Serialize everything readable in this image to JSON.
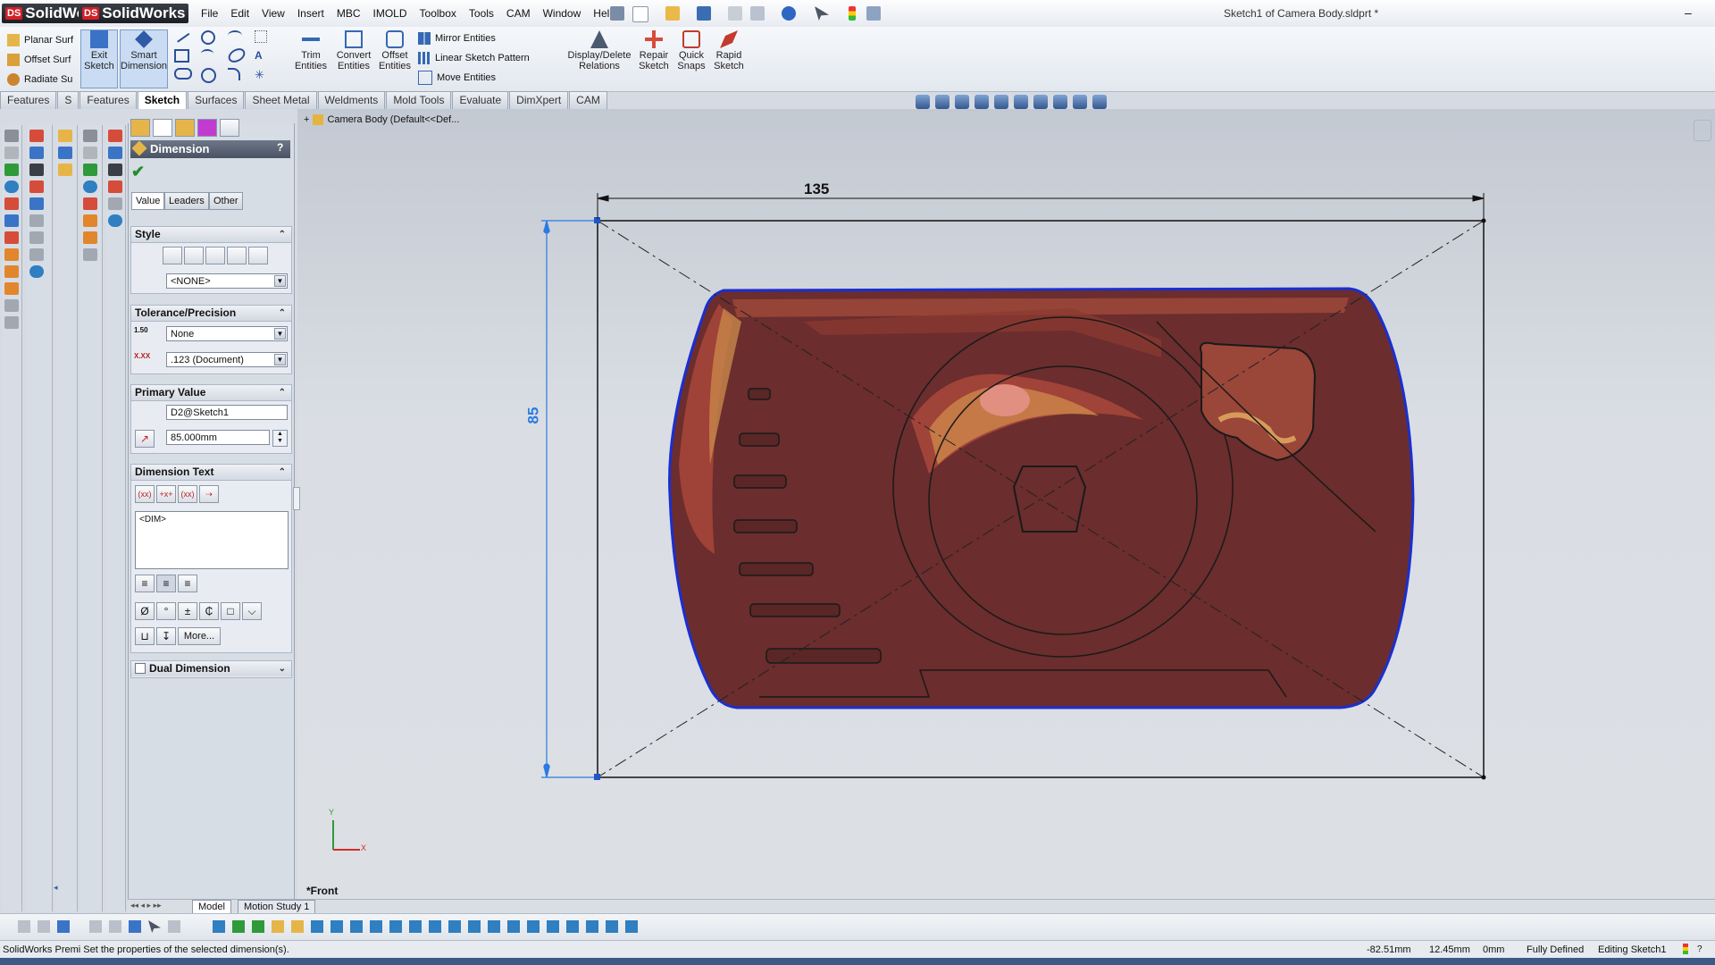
{
  "app": {
    "logo_text": "SolidWorks",
    "logo_text_2": "SolidWorks",
    "logo_badge": "DS",
    "document_title": "Sketch1 of Camera Body.sldprt *"
  },
  "menu": [
    "File",
    "Edit",
    "View",
    "Insert",
    "MBC",
    "IMOLD",
    "Toolbox",
    "Tools",
    "CAM",
    "Window",
    "Help"
  ],
  "command_manager": {
    "left_list": [
      "Planar Surf",
      "Offset Surf",
      "Radiate Su"
    ],
    "exit_sketch": "Exit Sketch",
    "smart_dimension": "Smart Dimension",
    "trim_entities": "Trim Entities",
    "convert_entities": "Convert Entities",
    "offset_entities": "Offset Entities",
    "mirror_entities": "Mirror Entities",
    "linear_pattern": "Linear Sketch Pattern",
    "move_entities": "Move Entities",
    "display_relations": "Display/Delete Relations",
    "repair_sketch": "Repair Sketch",
    "quick_snaps": "Quick Snaps",
    "rapid_sketch": "Rapid Sketch"
  },
  "tabs": [
    "Features",
    "S",
    "Features",
    "Sketch",
    "Surfaces",
    "Sheet Metal",
    "Weldments",
    "Mold Tools",
    "Evaluate",
    "DimXpert",
    "CAM"
  ],
  "active_tab_index": 3,
  "tree": {
    "root": "Camera Body  (Default<<Def..."
  },
  "property_manager": {
    "title": "Dimension",
    "help": "?",
    "tabs": [
      "Value",
      "Leaders",
      "Other"
    ],
    "style": {
      "header": "Style",
      "select": "<NONE>"
    },
    "tolerance": {
      "header": "Tolerance/Precision",
      "tolerance_type": "None",
      "precision": ".123 (Document)"
    },
    "primary": {
      "header": "Primary Value",
      "name": "D2@Sketch1",
      "value": "85.000mm"
    },
    "dim_text": {
      "header": "Dimension Text",
      "text": "<DIM>"
    },
    "symbols_more": "More...",
    "dual": {
      "header": "Dual Dimension"
    }
  },
  "graphics": {
    "dim_horizontal": "135",
    "dim_vertical": "85",
    "view_label": "*Front",
    "triad_x": "X",
    "triad_y": "Y"
  },
  "bottom_tabs": [
    "Model",
    "Motion Study 1"
  ],
  "status_bar": {
    "message": "SolidWorks Premi Set the properties of the selected dimension(s).",
    "x": "-82.51mm",
    "y": "12.45mm",
    "z": "0mm",
    "state": "Fully Defined",
    "mode": "Editing Sketch1"
  },
  "colors": {
    "accent": "#3d5a86",
    "dimension_blue": "#2a7ae2",
    "body_fill": "#6b2f2f",
    "outline_blue": "#1a2fd0"
  }
}
